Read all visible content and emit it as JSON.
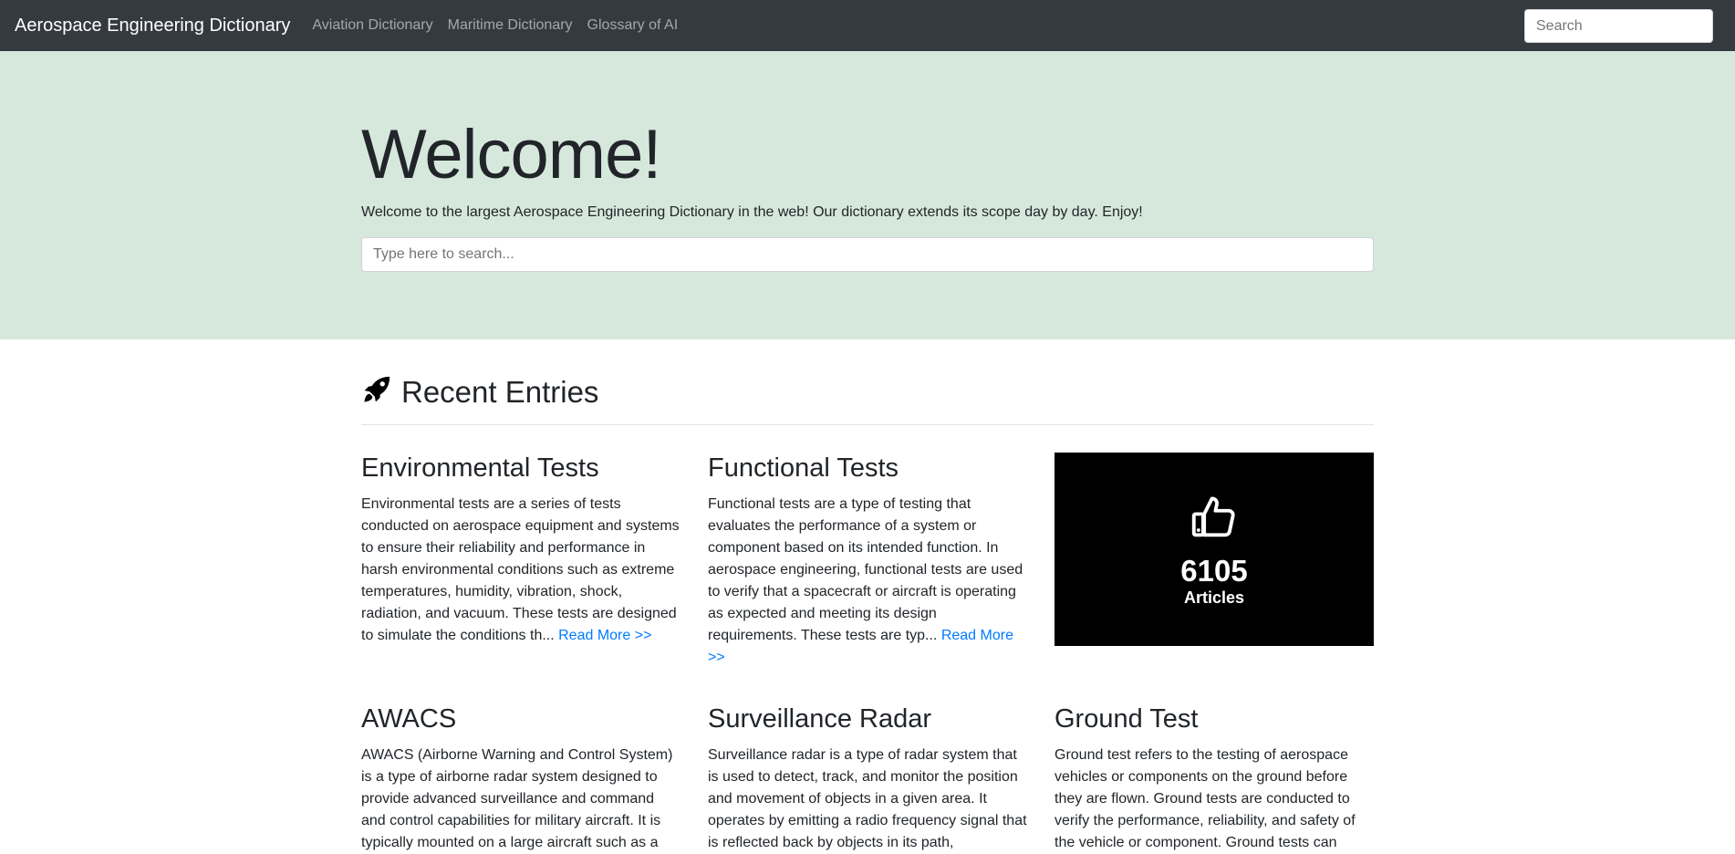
{
  "nav": {
    "brand": "Aerospace Engineering Dictionary",
    "links": [
      "Aviation Dictionary",
      "Maritime Dictionary",
      "Glossary of AI"
    ],
    "search_placeholder": "Search"
  },
  "hero": {
    "title": "Welcome!",
    "lead": "Welcome to the largest Aerospace Engineering Dictionary in the web! Our dictionary extends its scope day by day. Enjoy!",
    "search_placeholder": "Type here to search...",
    "background": "#d6e8dc"
  },
  "recent": {
    "title": "Recent Entries",
    "icon": "rocket-icon",
    "read_more": "Read More >>",
    "entries": [
      {
        "title": "Environmental Tests",
        "text": "Environmental tests are a series of tests conducted on aerospace equipment and systems to ensure their reliability and performance in harsh environmental conditions such as extreme temperatures, humidity, vibration, shock, radiation, and vacuum. These tests are designed to simulate the conditions th..."
      },
      {
        "title": "Functional Tests",
        "text": "Functional tests are a type of testing that evaluates the performance of a system or component based on its intended function. In aerospace engineering, functional tests are used to verify that a spacecraft or aircraft is operating as expected and meeting its design requirements. These tests are typ..."
      },
      {
        "title": "AWACS",
        "text": "AWACS (Airborne Warning and Control System) is a type of airborne radar system designed to provide advanced surveillance and command and control capabilities for military aircraft. It is typically mounted on a large aircraft such as a"
      },
      {
        "title": "Surveillance Radar",
        "text": "Surveillance radar is a type of radar system that is used to detect, track, and monitor the position and movement of objects in a given area. It operates by emitting a radio frequency signal that is reflected back by objects in its path,"
      },
      {
        "title": "Ground Test",
        "text": "Ground test refers to the testing of aerospace vehicles or components on the ground before they are flown. Ground tests are conducted to verify the performance, reliability, and safety of the vehicle or component. Ground tests can"
      }
    ]
  },
  "stats": {
    "icon": "thumbs-up-icon",
    "count": "6105",
    "label": "Articles"
  },
  "colors": {
    "navbar": "#343a40",
    "link": "#007bff",
    "stat_box": "#000000"
  }
}
